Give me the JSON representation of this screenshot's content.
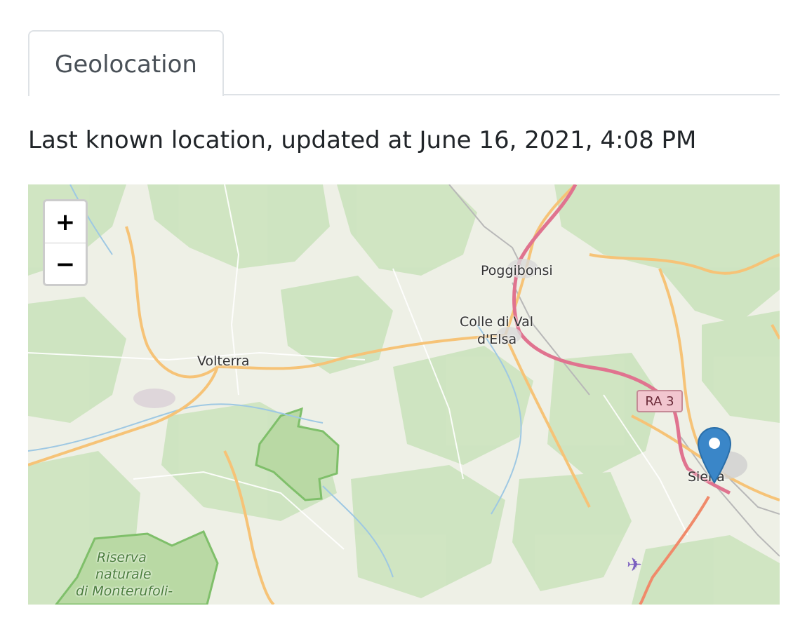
{
  "tabs": [
    {
      "label": "Geolocation"
    }
  ],
  "status": {
    "updated_text": "Last known location, updated at June 16, 2021, 4:08 PM"
  },
  "map": {
    "zoom_in_label": "+",
    "zoom_out_label": "−",
    "place_labels": {
      "poggibonsi": "Poggibonsi",
      "colle_line1": "Colle di Val",
      "colle_line2": "d'Elsa",
      "volterra": "Volterra",
      "siena": "Siena",
      "riserva_line1": "Riserva",
      "riserva_line2": "naturale",
      "riserva_line3": "di Monterufoli-"
    },
    "road_shield": "RA 3",
    "marker_color": "#3a86c8",
    "forest_color": "#cde4c0",
    "motorway_color": "#e0738f",
    "primary_road_color": "#f6c377"
  }
}
